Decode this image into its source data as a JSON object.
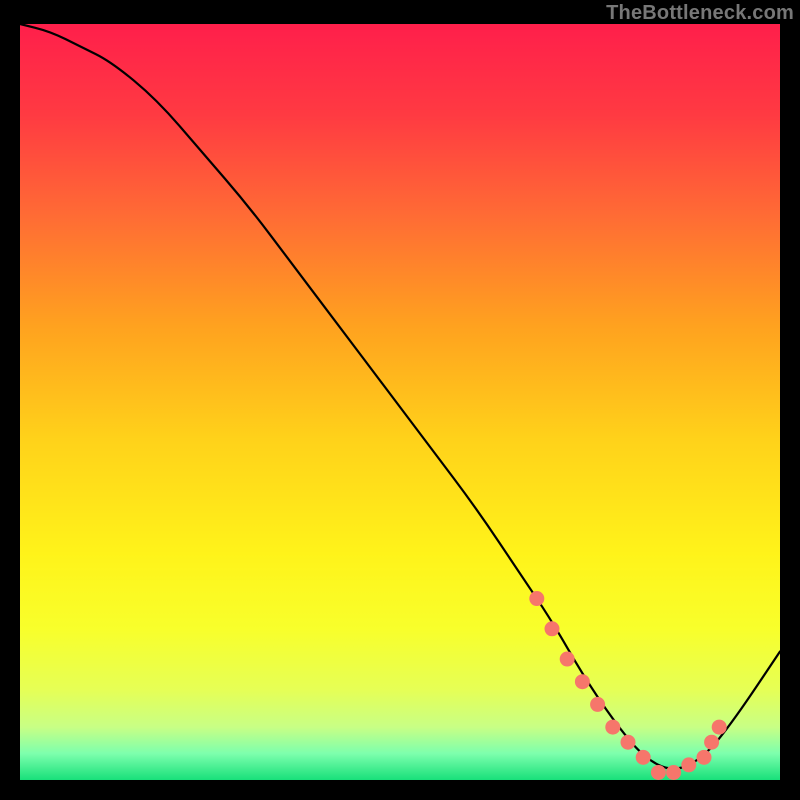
{
  "watermark": "TheBottleneck.com",
  "colors": {
    "background": "#000000",
    "curve": "#000000",
    "marker_fill": "#f6766b",
    "marker_stroke": "#f6766b"
  },
  "chart_data": {
    "type": "line",
    "title": "",
    "xlabel": "",
    "ylabel": "",
    "xlim": [
      0,
      100
    ],
    "ylim": [
      0,
      100
    ],
    "grid": false,
    "legend": false,
    "note": "V-shaped bottleneck curve over a red-to-green vertical gradient. Minimum sits near x≈84. Markers (salmon dots) cluster along the curve bottom from roughly x≈68 to x≈92.",
    "series": [
      {
        "name": "bottleneck-curve",
        "x": [
          0,
          4,
          8,
          12,
          18,
          24,
          30,
          36,
          42,
          48,
          54,
          60,
          66,
          70,
          74,
          78,
          82,
          86,
          90,
          94,
          100
        ],
        "y": [
          100,
          99,
          97,
          95,
          90,
          83,
          76,
          68,
          60,
          52,
          44,
          36,
          27,
          21,
          14,
          8,
          3,
          1,
          3,
          8,
          17
        ]
      }
    ],
    "markers": {
      "name": "highlight-dots",
      "x": [
        68,
        70,
        72,
        74,
        76,
        78,
        80,
        82,
        84,
        86,
        88,
        90,
        91,
        92
      ],
      "y": [
        24,
        20,
        16,
        13,
        10,
        7,
        5,
        3,
        1,
        1,
        2,
        3,
        5,
        7
      ]
    },
    "gradient_stops": [
      {
        "offset": 0.0,
        "color": "#ff1f4b"
      },
      {
        "offset": 0.12,
        "color": "#ff3a42"
      },
      {
        "offset": 0.25,
        "color": "#ff6a35"
      },
      {
        "offset": 0.4,
        "color": "#ffa21f"
      },
      {
        "offset": 0.55,
        "color": "#ffd21a"
      },
      {
        "offset": 0.7,
        "color": "#fff31a"
      },
      {
        "offset": 0.8,
        "color": "#f8ff2b"
      },
      {
        "offset": 0.88,
        "color": "#e6ff55"
      },
      {
        "offset": 0.93,
        "color": "#c8ff85"
      },
      {
        "offset": 0.965,
        "color": "#7dffad"
      },
      {
        "offset": 1.0,
        "color": "#18e07a"
      }
    ]
  }
}
